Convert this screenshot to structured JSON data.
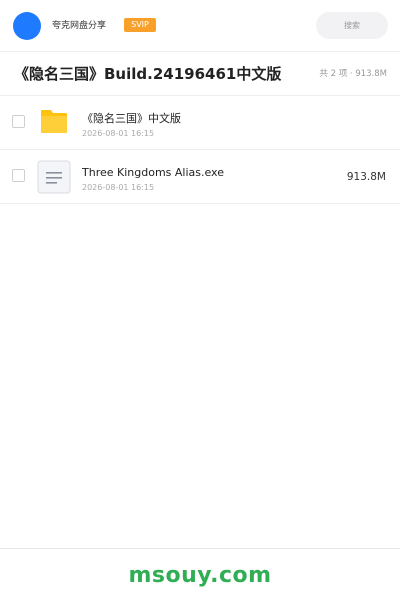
{
  "header": {
    "user_name": "夸克网盘分享",
    "badge": "SVIP",
    "search_placeholder": "搜索",
    "avatar_color": "#1e7bff"
  },
  "title_bar": {
    "title": "《隐名三国》Build.24196461中文版",
    "summary": "共 2 项 · 913.8M"
  },
  "files": [
    {
      "icon": "folder-icon",
      "name": "《隐名三国》中文版",
      "date": "2026-08-01 16:15",
      "size": ""
    },
    {
      "icon": "document-icon",
      "name": "Three Kingdoms Alias.exe",
      "date": "2026-08-01 16:15",
      "size": "913.8M"
    }
  ],
  "footer": {
    "watermark": "msouy.com",
    "watermark_color": "#2fae54"
  }
}
